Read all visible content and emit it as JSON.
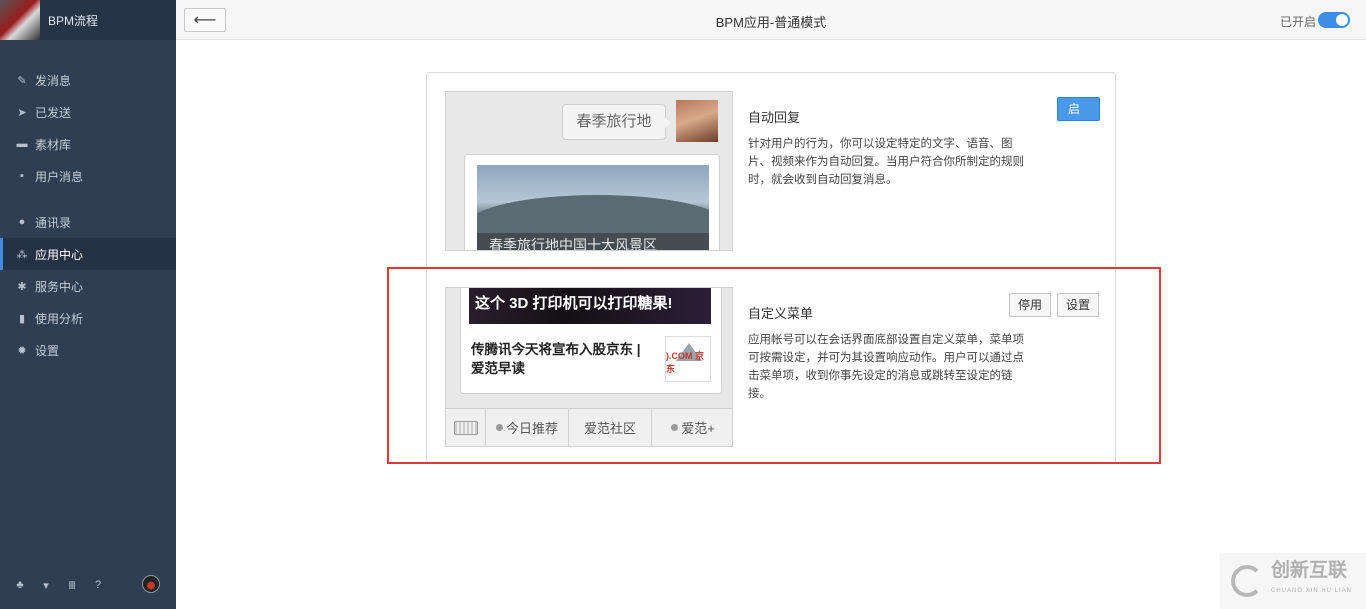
{
  "sidebar": {
    "brand": "BPM流程",
    "items": [
      {
        "label": "发消息",
        "icon": "pencil-icon"
      },
      {
        "label": "已发送",
        "icon": "send-icon"
      },
      {
        "label": "素材库",
        "icon": "folder-icon"
      },
      {
        "label": "用户消息",
        "icon": "chat-icon"
      },
      {
        "label": "通讯录",
        "icon": "contacts-icon"
      },
      {
        "label": "应用中心",
        "icon": "apps-icon",
        "active": true
      },
      {
        "label": "服务中心",
        "icon": "service-icon"
      },
      {
        "label": "使用分析",
        "icon": "chart-icon"
      },
      {
        "label": "设置",
        "icon": "gear-icon"
      }
    ],
    "footer_icons": [
      "tree-icon",
      "cart-icon",
      "book-icon",
      "help-icon"
    ]
  },
  "topbar": {
    "title": "BPM应用-普通模式",
    "status_label": "已开启",
    "toggle_on": true
  },
  "apps": [
    {
      "title": "自动回复",
      "description": "针对用户的行为，你可以设定特定的文字、语音、图片、视频来作为自动回复。当用户符合你所制定的规则时，就会收到自动回复消息。",
      "button": "启用",
      "preview": {
        "bubble_text": "春季旅行地",
        "caption": "春季旅行地中国十大风景区"
      }
    },
    {
      "title": "自定义菜单",
      "description": "应用帐号可以在会话界面底部设置自定义菜单，菜单项可按需设定，并可为其设置响应动作。用户可以通过点击菜单项，收到你事先设定的消息或跳转至设定的链接。",
      "buttons": {
        "disable": "停用",
        "settings": "设置"
      },
      "preview": {
        "banner": "这个 3D 打印机可以打印糖果!",
        "news": "传腾讯今天将宣布入股京东 | 爱范早读",
        "thumb_text": ").COM 京东",
        "menu": [
          "今日推荐",
          "爱范社区",
          "爱范+"
        ]
      }
    }
  ],
  "watermark": {
    "text": "创新互联",
    "sub": "CHUANG XIN HU LIAN"
  },
  "colors": {
    "sidebar": "#2f3e52",
    "accent": "#3d8ee5",
    "highlight": "#e03a3e"
  }
}
